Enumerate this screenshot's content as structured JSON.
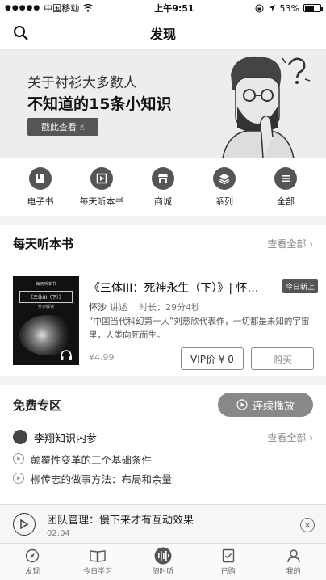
{
  "status": {
    "carrier": "中国移动",
    "time": "上午9:51",
    "battery": "53%",
    "battery_level": 0.53
  },
  "nav": {
    "title": "发现"
  },
  "banner": {
    "line1": "关于衬衫大多数人",
    "line2": "不知道的15条小知识",
    "button": "戳此查看"
  },
  "categories": [
    {
      "label": "电子书",
      "icon": "ebook-icon"
    },
    {
      "label": "每天听本书",
      "icon": "play-book-icon"
    },
    {
      "label": "商城",
      "icon": "store-icon"
    },
    {
      "label": "系列",
      "icon": "layers-icon"
    },
    {
      "label": "全部",
      "icon": "menu-icon"
    }
  ],
  "daily": {
    "title": "每天听本书",
    "more": "查看全部",
    "book": {
      "cover_top": "每天听本书",
      "cover_title": "《三体III（下）》",
      "cover_sub": "怀沙解读",
      "title": "《三体III：死神永生（下）》| 怀…",
      "badge": "今日新上",
      "author": "怀沙",
      "author_suffix": "讲述",
      "duration": "时长：29分4秒",
      "desc": "“中国当代科幻第一人”刘慈欣代表作，一切都是未知的宇宙里，人类向死而生。",
      "price": "¥4.99",
      "vip": "VIP价 ¥ 0",
      "buy": "购买"
    }
  },
  "free": {
    "title": "免费专区",
    "continue": "连续播放",
    "author": "李翔知识内参",
    "more": "查看全部",
    "episodes": [
      "颠覆性变革的三个基础条件",
      "柳传志的做事方法：布局和余量"
    ]
  },
  "player": {
    "title": "团队管理：慢下来才有互动效果",
    "time": "02:04"
  },
  "tabs": [
    {
      "label": "发现",
      "icon": "compass-icon"
    },
    {
      "label": "今日学习",
      "icon": "book-open-icon"
    },
    {
      "label": "随时听",
      "icon": "audio-wave-icon"
    },
    {
      "label": "已购",
      "icon": "purchased-icon"
    },
    {
      "label": "我的",
      "icon": "person-icon"
    }
  ]
}
